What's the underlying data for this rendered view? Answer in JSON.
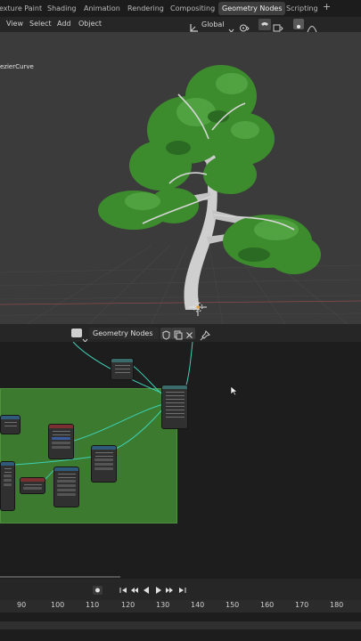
{
  "workspace_tabs": [
    "exture Paint",
    "Shading",
    "Animation",
    "Rendering",
    "Compositing",
    "Geometry Nodes",
    "Scripting",
    "+"
  ],
  "active_tab": "Geometry Nodes",
  "viewport_menu": [
    "View",
    "Select",
    "Add",
    "Object"
  ],
  "orientation": "Global",
  "object_name": "ezierCurve",
  "node_editor": {
    "tree_name": "Geometry Nodes",
    "frame_color": "#3b7a2f",
    "link_color": "#3fd0b5"
  },
  "timeline": {
    "frames": [
      "90",
      "100",
      "110",
      "120",
      "130",
      "140",
      "150",
      "160",
      "170",
      "180"
    ]
  },
  "icons": [
    "chevron-down-icon",
    "transform-pivot-icon",
    "snap-magnet-icon",
    "proportional-icon",
    "shield-icon",
    "duplicate-icon",
    "close-icon",
    "pin-icon",
    "record-icon",
    "jump-start-icon",
    "prev-keyframe-icon",
    "play-reverse-icon",
    "play-icon",
    "next-keyframe-icon",
    "jump-end-icon"
  ]
}
